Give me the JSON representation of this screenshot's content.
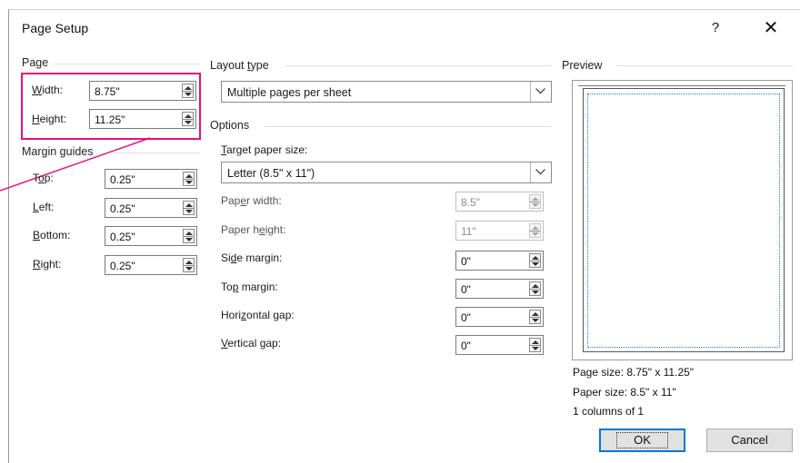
{
  "dialog": {
    "title": "Page Setup",
    "help_label": "?",
    "close_label": "✕"
  },
  "page": {
    "section_label": "Page",
    "width": {
      "label_accel": "W",
      "label_rest": "idth:",
      "value": "8.75\""
    },
    "height": {
      "label_accel": "H",
      "label_rest": "eight:",
      "value": "11.25\""
    }
  },
  "margin_guides": {
    "section_label": "Margin guides",
    "top": {
      "label_pre": "T",
      "label_accel": "o",
      "label_rest": "p:",
      "value": "0.25\""
    },
    "left": {
      "label_accel": "L",
      "label_rest": "eft:",
      "value": "0.25\""
    },
    "bottom": {
      "label_accel": "B",
      "label_rest": "ottom:",
      "value": "0.25\""
    },
    "right": {
      "label_accel": "R",
      "label_rest": "ight:",
      "value": "0.25\""
    }
  },
  "layout_type": {
    "section_label_pre": "Layout ",
    "section_label_accel": "t",
    "section_label_rest": "ype",
    "selected": "Multiple pages per sheet"
  },
  "options": {
    "section_label": "Options",
    "target_paper_size": {
      "label_accel": "T",
      "label_rest": "arget paper size:",
      "selected": "Letter (8.5\" x 11\")"
    },
    "paper_width": {
      "label_pre": "Pap",
      "label_accel": "e",
      "label_rest": "r width:",
      "value": "8.5\""
    },
    "paper_height": {
      "label_pre": "Paper h",
      "label_accel": "e",
      "label_rest": "ight:",
      "value": "11\""
    },
    "side_margin": {
      "label_pre": "Si",
      "label_accel": "d",
      "label_rest": "e margin:",
      "value": "0\""
    },
    "top_margin": {
      "label_pre": "To",
      "label_accel": "p",
      "label_rest": " margin:",
      "value": "0\""
    },
    "horizontal_gap": {
      "label_pre": "Hori",
      "label_accel": "z",
      "label_rest": "ontal gap:",
      "value": "0\""
    },
    "vertical_gap": {
      "label_accel": "V",
      "label_rest": "ertical gap:",
      "value": "0\""
    }
  },
  "preview": {
    "section_label": "Preview",
    "page_size": "Page size: 8.75\" x 11.25\"",
    "paper_size": "Paper size: 8.5\" x 11\"",
    "columns": "1 columns of 1"
  },
  "buttons": {
    "ok": "OK",
    "cancel": "Cancel"
  },
  "colors": {
    "highlight": "#e3117f",
    "accent": "#0078d7",
    "margin_line": "#1e7ad3"
  }
}
